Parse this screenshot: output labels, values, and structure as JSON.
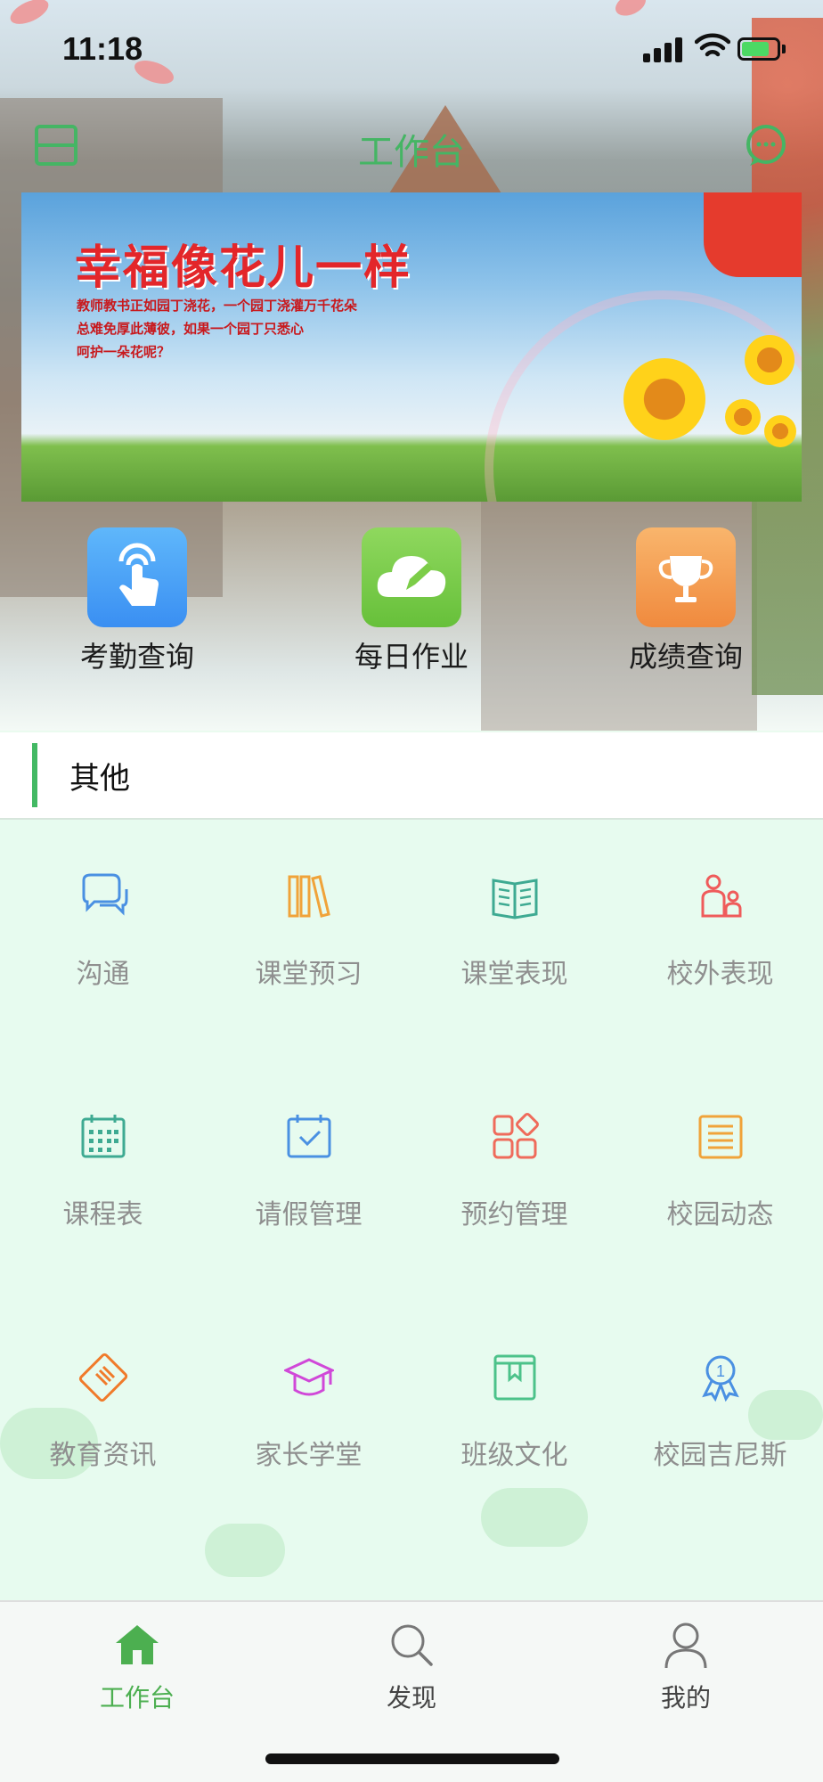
{
  "status_bar": {
    "time": "11:18"
  },
  "header": {
    "title": "工作台"
  },
  "banner": {
    "title": "幸福像花儿一样",
    "lines": [
      "教师教书正如园丁浇花，一个园丁浇灌万千花朵",
      "总难免厚此薄彼，如果一个园丁只悉心",
      "呵护一朵花呢？"
    ]
  },
  "quick_actions": [
    {
      "label": "考勤查询",
      "icon": "tap-hand-icon",
      "color": "#3f9ff5"
    },
    {
      "label": "每日作业",
      "icon": "cloud-edit-icon",
      "color": "#7ccd48"
    },
    {
      "label": "成绩查询",
      "icon": "trophy-icon",
      "color": "#f3994f"
    }
  ],
  "other_section": {
    "title": "其他"
  },
  "grid_items": [
    {
      "label": "沟通",
      "icon": "chat-bubbles-icon",
      "color": "#4a90e2"
    },
    {
      "label": "课堂预习",
      "icon": "books-icon",
      "color": "#f0a33a"
    },
    {
      "label": "课堂表现",
      "icon": "open-book-icon",
      "color": "#3eaa92"
    },
    {
      "label": "校外表现",
      "icon": "parent-child-icon",
      "color": "#ef5b5b"
    },
    {
      "label": "课程表",
      "icon": "calendar-grid-icon",
      "color": "#3eaa92"
    },
    {
      "label": "请假管理",
      "icon": "calendar-check-icon",
      "color": "#4a90e2"
    },
    {
      "label": "预约管理",
      "icon": "apps-icon",
      "color": "#ef6b5b"
    },
    {
      "label": "校园动态",
      "icon": "list-doc-icon",
      "color": "#f0a33a"
    },
    {
      "label": "教育资讯",
      "icon": "news-icon",
      "color": "#f07a2a"
    },
    {
      "label": "家长学堂",
      "icon": "graduation-cap-icon",
      "color": "#d048d8"
    },
    {
      "label": "班级文化",
      "icon": "bookmark-book-icon",
      "color": "#4cc28a"
    },
    {
      "label": "校园吉尼斯",
      "icon": "award-ribbon-icon",
      "color": "#4a90e2"
    }
  ],
  "tabbar": {
    "items": [
      {
        "label": "工作台",
        "icon": "home-icon",
        "active": true
      },
      {
        "label": "发现",
        "icon": "search-icon",
        "active": false
      },
      {
        "label": "我的",
        "icon": "user-icon",
        "active": false
      }
    ],
    "active_color": "#4caf50",
    "inactive_color": "#444444"
  }
}
